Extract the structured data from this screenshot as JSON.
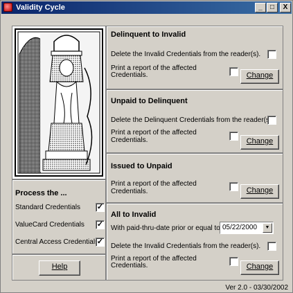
{
  "window": {
    "title": "Validity Cycle",
    "minimize": "_",
    "maximize": "□",
    "close": "X"
  },
  "left": {
    "process_heading": "Process the ...",
    "credentials": [
      {
        "label": "Standard Credentials",
        "checked": true
      },
      {
        "label": "ValueCard Credentials",
        "checked": true
      },
      {
        "label": "Central Access Credentials",
        "checked": true
      }
    ],
    "help_button": "Help"
  },
  "sections": {
    "delinquent_to_invalid": {
      "title": "Delinquent to Invalid",
      "delete_label": "Delete the Invalid Credentials from the reader(s).",
      "report_line1": "Print a report of the affected",
      "report_line2": "Credentials.",
      "change": "Change"
    },
    "unpaid_to_delinquent": {
      "title": "Unpaid to Delinquent",
      "delete_label": "Delete the Delinquent Credentials from the reader(s).",
      "report_line1": "Print a report of the affected",
      "report_line2": "Credentials.",
      "change": "Change"
    },
    "issued_to_unpaid": {
      "title": "Issued to Unpaid",
      "report_line1": "Print a report of the affected",
      "report_line2": "Credentials.",
      "change": "Change"
    },
    "all_to_invalid": {
      "title": "All to Invalid",
      "date_label": "With paid-thru-date prior or equal to",
      "date_value": "05/22/2000",
      "delete_label": "Delete the Invalid Credentials from the reader(s).",
      "report_line1": "Print a report of the affected",
      "report_line2": "Credentials.",
      "change": "Change"
    }
  },
  "status": {
    "version": "Ver 2.0 - 03/30/2002"
  },
  "colors": {
    "face": "#d4d0c8",
    "title_start": "#0a246a",
    "title_end": "#3a6ea5"
  }
}
